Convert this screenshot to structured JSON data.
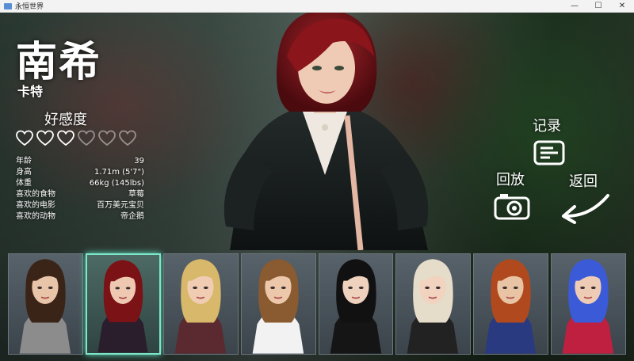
{
  "window": {
    "title": "永恒世界",
    "min": "—",
    "max": "☐",
    "close": "✕"
  },
  "character": {
    "name": "南希",
    "surname": "卡特",
    "affinity_label": "好感度",
    "affinity_filled": 3,
    "affinity_total": 6,
    "stats": [
      {
        "label": "年龄",
        "value": "39"
      },
      {
        "label": "身高",
        "value": "1.71m (5'7\")"
      },
      {
        "label": "体重",
        "value": "66kg (145lbs)"
      },
      {
        "label": "喜欢的食物",
        "value": "草莓"
      },
      {
        "label": "喜欢的电影",
        "value": "百万美元宝贝"
      },
      {
        "label": "喜欢的动物",
        "value": "帝企鹅"
      }
    ]
  },
  "buttons": {
    "record": "记录",
    "replay": "回放",
    "back": "返回"
  },
  "roster": [
    {
      "name": "char-1",
      "hair": "#3a2418",
      "outfit": "#8c8c8c",
      "skin": "#e8c4a8"
    },
    {
      "name": "char-2",
      "hair": "#7a1216",
      "outfit": "#2a1e2c",
      "skin": "#eec8b0",
      "selected": true
    },
    {
      "name": "char-3",
      "hair": "#d8b86a",
      "outfit": "#5a2a30",
      "skin": "#f0cdb2"
    },
    {
      "name": "char-4",
      "hair": "#8a5a30",
      "outfit": "#f2f2f2",
      "skin": "#ecc7aa"
    },
    {
      "name": "char-5",
      "hair": "#111111",
      "outfit": "#151515",
      "skin": "#efd2bd"
    },
    {
      "name": "char-6",
      "hair": "#e6dcca",
      "outfit": "#222222",
      "skin": "#f1d3bf"
    },
    {
      "name": "char-7",
      "hair": "#b04a1e",
      "outfit": "#2a3a80",
      "skin": "#e9c4a4"
    },
    {
      "name": "char-8",
      "hair": "#3a5ad8",
      "outfit": "#c02040",
      "skin": "#eecbb4"
    }
  ],
  "colors": {
    "accent": "#7de6c9",
    "text": "#ffffff"
  }
}
